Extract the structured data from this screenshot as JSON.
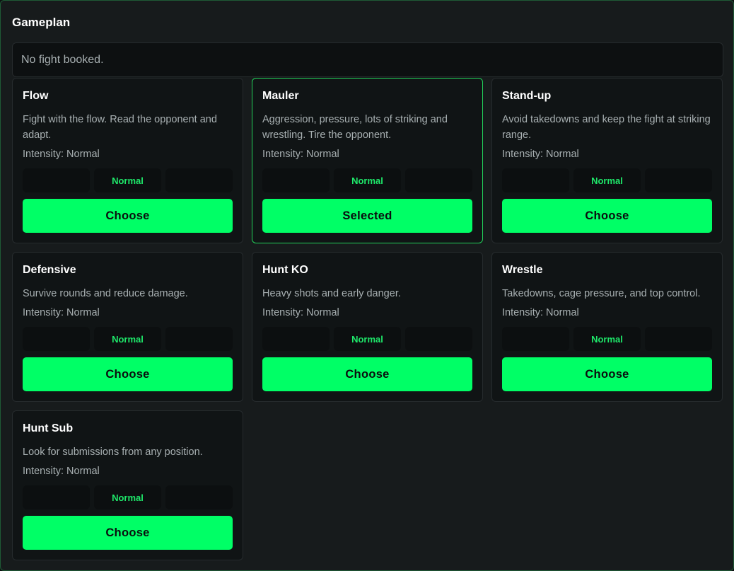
{
  "title": "Gameplan",
  "notice": "No fight booked.",
  "intensity_label": "Intensity:",
  "accent_color": "#00ff66",
  "selected_border_color": "#22d15a",
  "cards": [
    {
      "name": "Flow",
      "description": "Fight with the flow. Read the opponent and adapt.",
      "intensity": "Normal",
      "segments": [
        "",
        "Normal",
        ""
      ],
      "button": "Choose",
      "selected": false
    },
    {
      "name": "Mauler",
      "description": "Aggression, pressure, lots of striking and wrestling. Tire the opponent.",
      "intensity": "Normal",
      "segments": [
        "",
        "Normal",
        ""
      ],
      "button": "Selected",
      "selected": true
    },
    {
      "name": "Stand-up",
      "description": "Avoid takedowns and keep the fight at striking range.",
      "intensity": "Normal",
      "segments": [
        "",
        "Normal",
        ""
      ],
      "button": "Choose",
      "selected": false
    },
    {
      "name": "Defensive",
      "description": "Survive rounds and reduce damage.",
      "intensity": "Normal",
      "segments": [
        "",
        "Normal",
        ""
      ],
      "button": "Choose",
      "selected": false
    },
    {
      "name": "Hunt KO",
      "description": "Heavy shots and early danger.",
      "intensity": "Normal",
      "segments": [
        "",
        "Normal",
        ""
      ],
      "button": "Choose",
      "selected": false
    },
    {
      "name": "Wrestle",
      "description": "Takedowns, cage pressure, and top control.",
      "intensity": "Normal",
      "segments": [
        "",
        "Normal",
        ""
      ],
      "button": "Choose",
      "selected": false
    },
    {
      "name": "Hunt Sub",
      "description": "Look for submissions from any position.",
      "intensity": "Normal",
      "segments": [
        "",
        "Normal",
        ""
      ],
      "button": "Choose",
      "selected": false
    }
  ]
}
